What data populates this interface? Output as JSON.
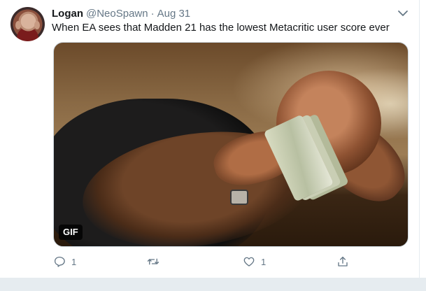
{
  "tweet": {
    "name": "Logan",
    "handle": "@NeoSpawn",
    "separator": "·",
    "date": "Aug 31",
    "text": "When EA sees that Madden 21 has the lowest Metacritic user score ever",
    "media": {
      "badge": "GIF"
    },
    "actions": {
      "reply_icon": "reply-icon",
      "reply_count": "1",
      "retweet_icon": "retweet-icon",
      "like_icon": "heart-icon",
      "like_count": "1",
      "share_icon": "share-icon"
    },
    "menu_icon": "chevron-down-icon"
  },
  "colors": {
    "text_primary": "#14171a",
    "text_secondary": "#657786",
    "border": "#e6ecf0"
  }
}
